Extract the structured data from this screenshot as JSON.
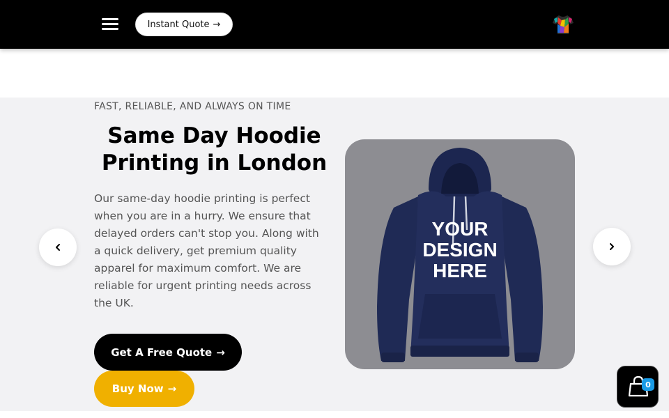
{
  "header": {
    "menu_icon": "hamburger-menu-icon",
    "quote_label": "Instant Quote",
    "quote_arrow": "→",
    "logo_icon": "colorful-tshirt-logo-icon"
  },
  "hero": {
    "eyebrow": "FAST, RELIABLE, AND ALWAYS ON TIME",
    "title": "Same Day Hoodie Printing in London",
    "description": "Our same-day hoodie printing is perfect when you are in a hurry. We ensure that delayed orders can't stop you. Along with a quick delivery, get premium quality apparel for maximum comfort. We are reliable for urgent printing needs across the UK.",
    "cta_quote_label": "Get A Free Quote",
    "cta_buy_label": "Buy Now",
    "cta_arrow": "→"
  },
  "product": {
    "print_text_line1": "YOUR",
    "print_text_line2": "DESIGN",
    "print_text_line3": "HERE",
    "color": "#1f2a52"
  },
  "carousel": {
    "prev_icon": "chevron-left-icon",
    "next_icon": "chevron-right-icon"
  },
  "cart": {
    "icon": "shopping-bag-icon",
    "count": "0"
  },
  "colors": {
    "header_bg": "#000000",
    "hero_bg": "#f2f2f4",
    "accent_yellow": "#f0b000",
    "badge_blue": "#1a9be6"
  }
}
